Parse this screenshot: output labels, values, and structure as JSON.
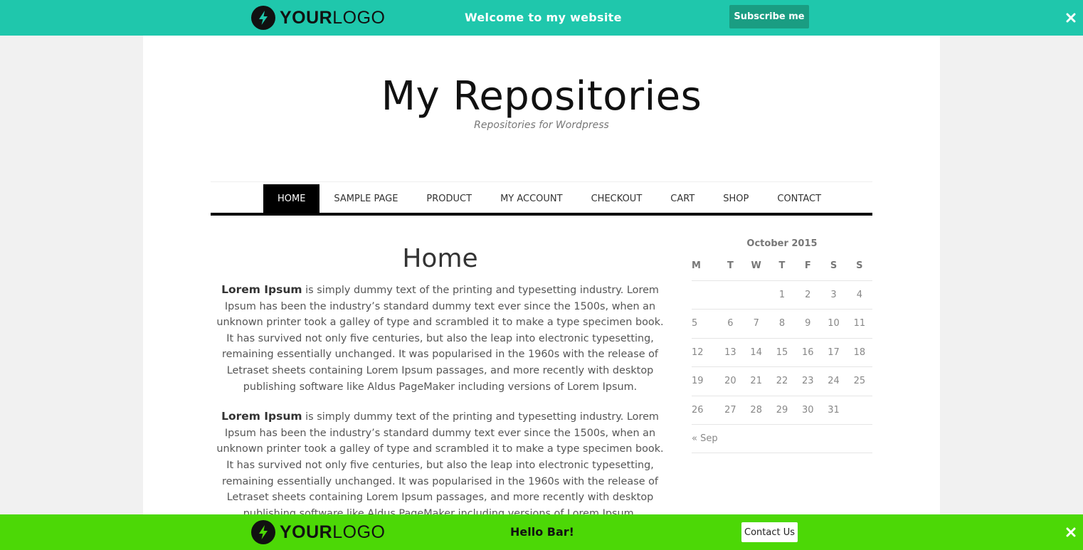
{
  "top_bar": {
    "logo_bold": "YOUR",
    "logo_light": "LOGO",
    "message": "Welcome to my website",
    "button_label": "Subscribe me",
    "background": "#1fc7ac"
  },
  "site": {
    "title": "My Repositories",
    "tagline": "Repositories for Wordpress"
  },
  "nav": {
    "items": [
      "HOME",
      "SAMPLE PAGE",
      "PRODUCT",
      "MY ACCOUNT",
      "CHECKOUT",
      "CART",
      "SHOP",
      "CONTACT"
    ],
    "active": "HOME"
  },
  "content": {
    "heading": "Home",
    "paragraphs": [
      {
        "lead": "Lorem Ipsum",
        "text": " is simply dummy text of the printing and typesetting industry. Lorem Ipsum has been the industry’s standard dummy text ever since the 1500s, when an unknown printer took a galley of type and scrambled it to make a type specimen book. It has survived not only five centuries, but also the leap into electronic typesetting, remaining essentially unchanged. It was popularised in the 1960s with the release of Letraset sheets containing Lorem Ipsum passages, and more recently with desktop publishing software like Aldus PageMaker including versions of Lorem Ipsum."
      },
      {
        "lead": "Lorem Ipsum",
        "text": " is simply dummy text of the printing and typesetting industry. Lorem Ipsum has been the industry’s standard dummy text ever since the 1500s, when an unknown printer took a galley of type and scrambled it to make a type specimen book. It has survived not only five centuries, but also the leap into electronic typesetting, remaining essentially unchanged. It was popularised in the 1960s with the release of Letraset sheets containing Lorem Ipsum passages, and more recently with desktop publishing software like Aldus PageMaker including versions of Lorem Ipsum."
      }
    ]
  },
  "calendar": {
    "caption": "October 2015",
    "weekdays": [
      "M",
      "T",
      "W",
      "T",
      "F",
      "S",
      "S"
    ],
    "weeks": [
      [
        "",
        "",
        "",
        "1",
        "2",
        "3",
        "4"
      ],
      [
        "5",
        "6",
        "7",
        "8",
        "9",
        "10",
        "11"
      ],
      [
        "12",
        "13",
        "14",
        "15",
        "16",
        "17",
        "18"
      ],
      [
        "19",
        "20",
        "21",
        "22",
        "23",
        "24",
        "25"
      ],
      [
        "26",
        "27",
        "28",
        "29",
        "30",
        "31",
        ""
      ]
    ],
    "prev_link": "« Sep"
  },
  "bottom_bar": {
    "logo_bold": "YOUR",
    "logo_light": "LOGO",
    "message": "Hello Bar!",
    "button_label": "Contact Us",
    "background": "#4cd806"
  }
}
